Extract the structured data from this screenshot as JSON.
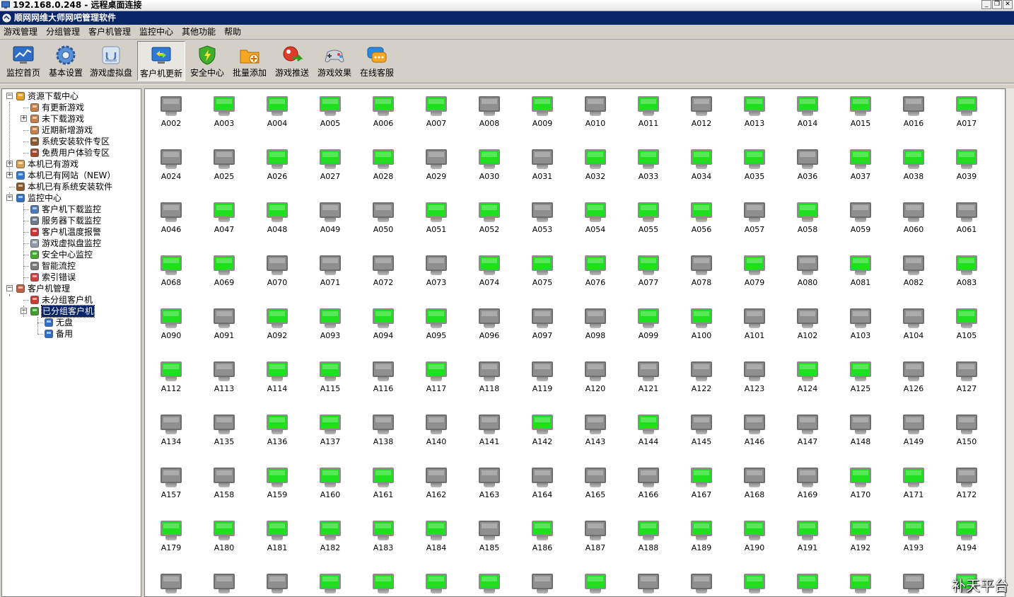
{
  "rdp": {
    "title": "192.168.0.248 - 远程桌面连接"
  },
  "app": {
    "title": "顺网网维大师网吧管理软件"
  },
  "menu": [
    "游戏管理",
    "分组管理",
    "客户机管理",
    "监控中心",
    "其他功能",
    "帮助"
  ],
  "toolbar": [
    {
      "label": "监控首页",
      "icon": "monitor-home-icon"
    },
    {
      "label": "基本设置",
      "icon": "gear-icon"
    },
    {
      "label": "游戏虚拟盘",
      "icon": "virtual-disk-icon"
    },
    {
      "label": "客户机更新",
      "icon": "client-update-icon",
      "active": true
    },
    {
      "label": "安全中心",
      "icon": "shield-icon"
    },
    {
      "label": "批量添加",
      "icon": "folder-add-icon"
    },
    {
      "label": "游戏推送",
      "icon": "game-push-icon"
    },
    {
      "label": "游戏效果",
      "icon": "gamepad-icon"
    },
    {
      "label": "在线客服",
      "icon": "chat-icon"
    }
  ],
  "tree": [
    {
      "label": "资源下载中心",
      "icon": "download-center-icon",
      "level": 0,
      "expander": "-"
    },
    {
      "label": "有更新游戏",
      "icon": "user-icon",
      "level": 1
    },
    {
      "label": "未下载游戏",
      "icon": "user-icon",
      "level": 1,
      "expander": "+"
    },
    {
      "label": "近期新增游戏",
      "icon": "user-icon",
      "level": 1
    },
    {
      "label": "系统安装软件专区",
      "icon": "grid-icon",
      "level": 1
    },
    {
      "label": "免费用户体验专区",
      "icon": "car-icon",
      "level": 1
    },
    {
      "label": "本机已有游戏",
      "icon": "box-icon",
      "level": 0,
      "expander": "+"
    },
    {
      "label": "本机已有网站（NEW）",
      "icon": "ie-icon",
      "level": 0,
      "expander": "+"
    },
    {
      "label": "本机已有系统安装软件",
      "icon": "grid-icon",
      "level": 0
    },
    {
      "label": "监控中心",
      "icon": "monitor-icon",
      "level": 0,
      "expander": "-"
    },
    {
      "label": "客户机下载监控",
      "icon": "client-icon",
      "level": 1
    },
    {
      "label": "服务器下载监控",
      "icon": "server-icon",
      "level": 1
    },
    {
      "label": "客户机温度报警",
      "icon": "thermometer-icon",
      "level": 1
    },
    {
      "label": "游戏虚拟盘监控",
      "icon": "disk-icon",
      "level": 1
    },
    {
      "label": "安全中心监控",
      "icon": "shield-icon",
      "level": 1
    },
    {
      "label": "智能流控",
      "icon": "flow-control-icon",
      "level": 1
    },
    {
      "label": "索引错误",
      "icon": "index-error-icon",
      "level": 1
    },
    {
      "label": "客户机管理",
      "icon": "client-manage-icon",
      "level": 0,
      "expander": "-"
    },
    {
      "label": "未分组客户机",
      "icon": "ungrouped-icon",
      "level": 1
    },
    {
      "label": "已分组客户机",
      "icon": "grouped-icon",
      "level": 1,
      "expander": "-",
      "selected": true
    },
    {
      "label": "无盘",
      "icon": "network-icon",
      "level": 2
    },
    {
      "label": "备用",
      "icon": "network-icon",
      "level": 2
    }
  ],
  "clients": {
    "columns": 16,
    "items": [
      {
        "name": "A002",
        "on": false
      },
      {
        "name": "A003",
        "on": true
      },
      {
        "name": "A004",
        "on": true
      },
      {
        "name": "A005",
        "on": true
      },
      {
        "name": "A006",
        "on": true
      },
      {
        "name": "A007",
        "on": true
      },
      {
        "name": "A008",
        "on": false
      },
      {
        "name": "A009",
        "on": true
      },
      {
        "name": "A010",
        "on": false
      },
      {
        "name": "A011",
        "on": true
      },
      {
        "name": "A012",
        "on": false
      },
      {
        "name": "A013",
        "on": true
      },
      {
        "name": "A014",
        "on": true
      },
      {
        "name": "A015",
        "on": true
      },
      {
        "name": "A016",
        "on": false
      },
      {
        "name": "A017",
        "on": true
      },
      {
        "name": "A024",
        "on": false
      },
      {
        "name": "A025",
        "on": false
      },
      {
        "name": "A026",
        "on": true
      },
      {
        "name": "A027",
        "on": true
      },
      {
        "name": "A028",
        "on": true
      },
      {
        "name": "A029",
        "on": false
      },
      {
        "name": "A030",
        "on": true
      },
      {
        "name": "A031",
        "on": false
      },
      {
        "name": "A032",
        "on": true
      },
      {
        "name": "A033",
        "on": true
      },
      {
        "name": "A034",
        "on": true
      },
      {
        "name": "A035",
        "on": true
      },
      {
        "name": "A036",
        "on": false
      },
      {
        "name": "A037",
        "on": true
      },
      {
        "name": "A038",
        "on": true
      },
      {
        "name": "A039",
        "on": true
      },
      {
        "name": "A046",
        "on": false
      },
      {
        "name": "A047",
        "on": true
      },
      {
        "name": "A048",
        "on": true
      },
      {
        "name": "A049",
        "on": false
      },
      {
        "name": "A050",
        "on": false
      },
      {
        "name": "A051",
        "on": true
      },
      {
        "name": "A052",
        "on": true
      },
      {
        "name": "A053",
        "on": false
      },
      {
        "name": "A054",
        "on": true
      },
      {
        "name": "A055",
        "on": true
      },
      {
        "name": "A056",
        "on": true
      },
      {
        "name": "A057",
        "on": false
      },
      {
        "name": "A058",
        "on": true
      },
      {
        "name": "A059",
        "on": false
      },
      {
        "name": "A060",
        "on": false
      },
      {
        "name": "A061",
        "on": false
      },
      {
        "name": "A068",
        "on": true
      },
      {
        "name": "A069",
        "on": true
      },
      {
        "name": "A070",
        "on": false
      },
      {
        "name": "A071",
        "on": false
      },
      {
        "name": "A072",
        "on": false
      },
      {
        "name": "A073",
        "on": false
      },
      {
        "name": "A074",
        "on": true
      },
      {
        "name": "A075",
        "on": true
      },
      {
        "name": "A076",
        "on": true
      },
      {
        "name": "A077",
        "on": true
      },
      {
        "name": "A078",
        "on": false
      },
      {
        "name": "A079",
        "on": true
      },
      {
        "name": "A080",
        "on": false
      },
      {
        "name": "A081",
        "on": true
      },
      {
        "name": "A082",
        "on": false
      },
      {
        "name": "A083",
        "on": true
      },
      {
        "name": "A090",
        "on": true
      },
      {
        "name": "A091",
        "on": false
      },
      {
        "name": "A092",
        "on": true
      },
      {
        "name": "A093",
        "on": true
      },
      {
        "name": "A094",
        "on": true
      },
      {
        "name": "A095",
        "on": true
      },
      {
        "name": "A096",
        "on": false
      },
      {
        "name": "A097",
        "on": false
      },
      {
        "name": "A098",
        "on": false
      },
      {
        "name": "A099",
        "on": true
      },
      {
        "name": "A100",
        "on": true
      },
      {
        "name": "A101",
        "on": false
      },
      {
        "name": "A102",
        "on": false
      },
      {
        "name": "A103",
        "on": false
      },
      {
        "name": "A104",
        "on": false
      },
      {
        "name": "A105",
        "on": true
      },
      {
        "name": "A112",
        "on": true
      },
      {
        "name": "A113",
        "on": false
      },
      {
        "name": "A114",
        "on": true
      },
      {
        "name": "A115",
        "on": true
      },
      {
        "name": "A116",
        "on": false
      },
      {
        "name": "A117",
        "on": true
      },
      {
        "name": "A118",
        "on": false
      },
      {
        "name": "A119",
        "on": false
      },
      {
        "name": "A120",
        "on": false
      },
      {
        "name": "A121",
        "on": false
      },
      {
        "name": "A122",
        "on": false
      },
      {
        "name": "A123",
        "on": false
      },
      {
        "name": "A124",
        "on": true
      },
      {
        "name": "A125",
        "on": true
      },
      {
        "name": "A126",
        "on": false
      },
      {
        "name": "A127",
        "on": false
      },
      {
        "name": "A134",
        "on": false
      },
      {
        "name": "A135",
        "on": false
      },
      {
        "name": "A136",
        "on": true
      },
      {
        "name": "A137",
        "on": true
      },
      {
        "name": "A138",
        "on": false
      },
      {
        "name": "A140",
        "on": false
      },
      {
        "name": "A141",
        "on": false
      },
      {
        "name": "A142",
        "on": true
      },
      {
        "name": "A143",
        "on": false
      },
      {
        "name": "A144",
        "on": true
      },
      {
        "name": "A145",
        "on": false
      },
      {
        "name": "A146",
        "on": false
      },
      {
        "name": "A147",
        "on": false
      },
      {
        "name": "A148",
        "on": false
      },
      {
        "name": "A149",
        "on": false
      },
      {
        "name": "A150",
        "on": false
      },
      {
        "name": "A157",
        "on": false
      },
      {
        "name": "A158",
        "on": false
      },
      {
        "name": "A159",
        "on": true
      },
      {
        "name": "A160",
        "on": true
      },
      {
        "name": "A161",
        "on": true
      },
      {
        "name": "A162",
        "on": false
      },
      {
        "name": "A163",
        "on": false
      },
      {
        "name": "A164",
        "on": false
      },
      {
        "name": "A165",
        "on": false
      },
      {
        "name": "A166",
        "on": false
      },
      {
        "name": "A167",
        "on": true
      },
      {
        "name": "A168",
        "on": false
      },
      {
        "name": "A169",
        "on": false
      },
      {
        "name": "A170",
        "on": true
      },
      {
        "name": "A171",
        "on": true
      },
      {
        "name": "A172",
        "on": false
      },
      {
        "name": "A179",
        "on": true
      },
      {
        "name": "A180",
        "on": true
      },
      {
        "name": "A181",
        "on": true
      },
      {
        "name": "A182",
        "on": true
      },
      {
        "name": "A183",
        "on": true
      },
      {
        "name": "A184",
        "on": true
      },
      {
        "name": "A185",
        "on": false
      },
      {
        "name": "A186",
        "on": true
      },
      {
        "name": "A187",
        "on": false
      },
      {
        "name": "A188",
        "on": true
      },
      {
        "name": "A189",
        "on": true
      },
      {
        "name": "A190",
        "on": true
      },
      {
        "name": "A191",
        "on": true
      },
      {
        "name": "A192",
        "on": true
      },
      {
        "name": "A193",
        "on": true
      },
      {
        "name": "A194",
        "on": true
      },
      {
        "name": "",
        "on": false
      },
      {
        "name": "",
        "on": false
      },
      {
        "name": "",
        "on": false
      },
      {
        "name": "",
        "on": true
      },
      {
        "name": "",
        "on": true
      },
      {
        "name": "",
        "on": true
      },
      {
        "name": "",
        "on": true
      },
      {
        "name": "",
        "on": false
      },
      {
        "name": "",
        "on": true
      },
      {
        "name": "",
        "on": false
      },
      {
        "name": "",
        "on": false
      },
      {
        "name": "",
        "on": true
      },
      {
        "name": "",
        "on": true
      },
      {
        "name": "",
        "on": true
      },
      {
        "name": "",
        "on": false
      },
      {
        "name": "",
        "on": true
      }
    ]
  },
  "watermark": "补天平台",
  "colors": {
    "online": "#1fe01f",
    "offline": "#8f8f8f",
    "titlebar": "#0a246a",
    "chrome": "#d4d0c8"
  }
}
